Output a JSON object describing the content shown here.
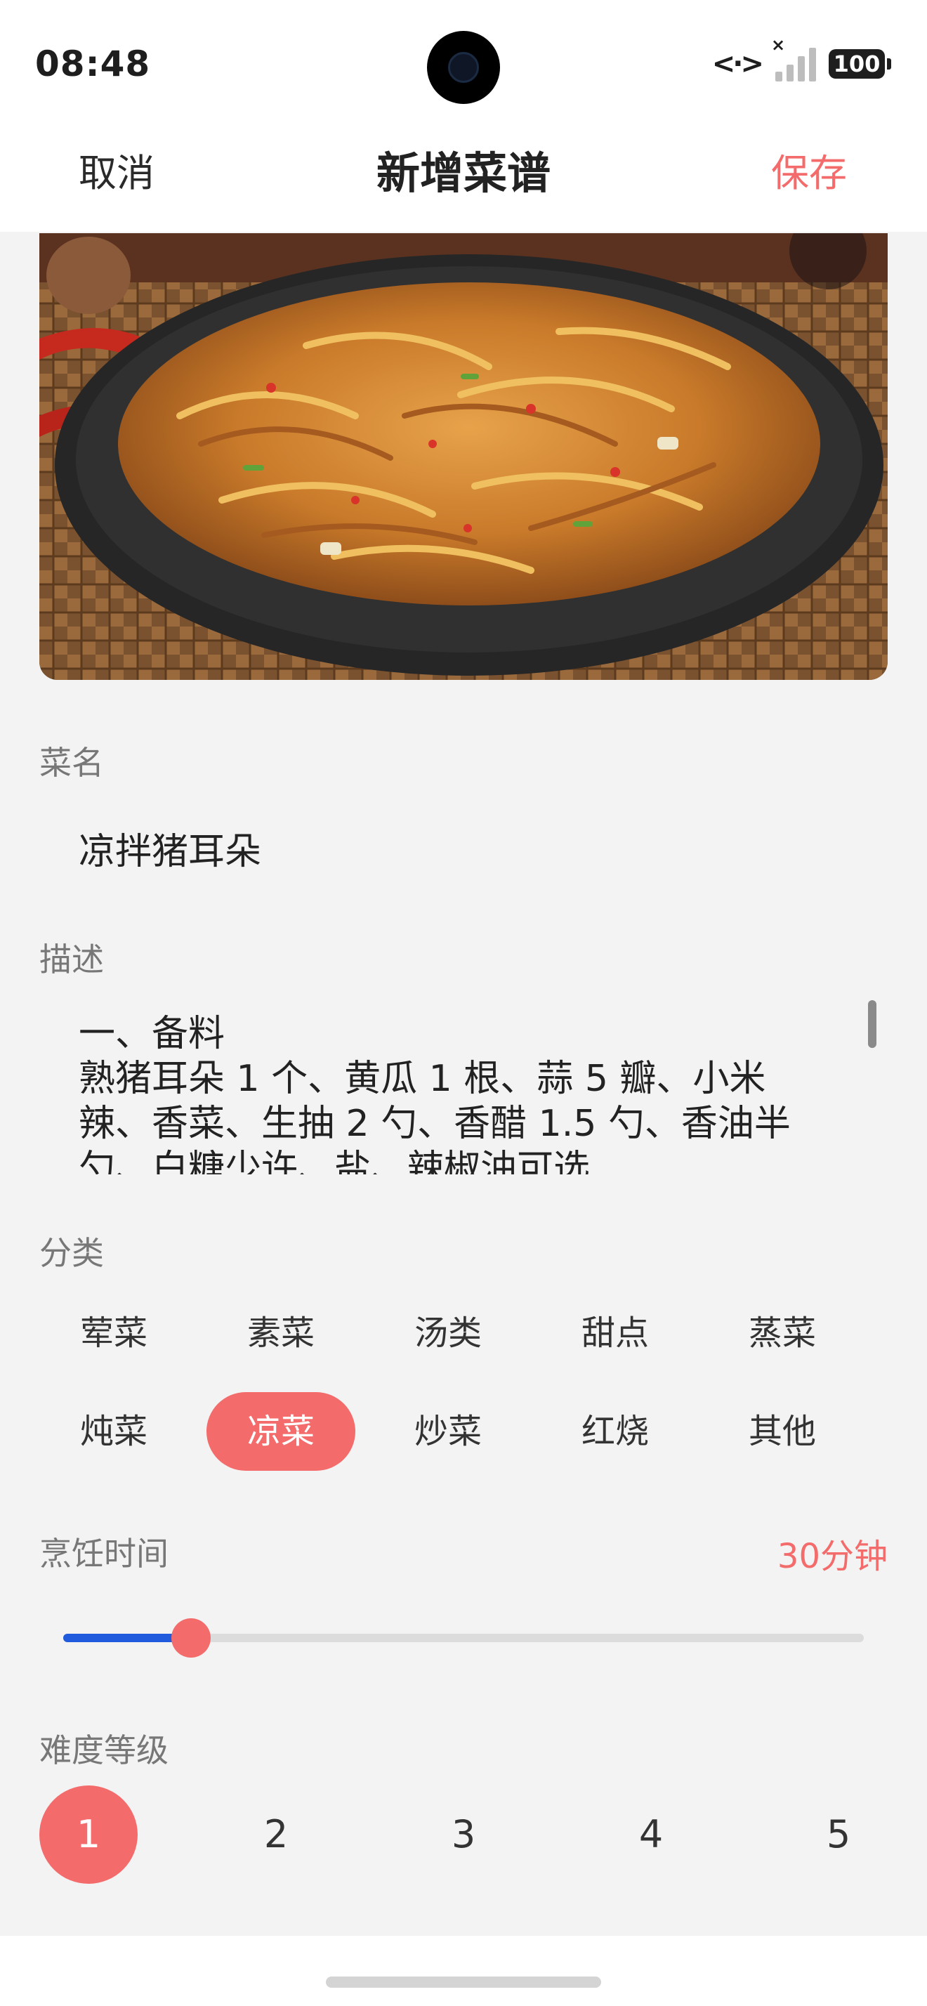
{
  "status_bar": {
    "time": "08:48",
    "battery": "100",
    "icons": [
      "camera-icon",
      "data-transfer-icon",
      "signal-icon",
      "battery-icon"
    ]
  },
  "nav": {
    "cancel_label": "取消",
    "title": "新增菜谱",
    "save_label": "保存"
  },
  "photo": {
    "subject": "dish-photo"
  },
  "form": {
    "name_label": "菜名",
    "name_value": "凉拌猪耳朵",
    "desc_label": "描述",
    "desc_lines": [
      "一、备料",
      "熟猪耳朵 1 个、黄瓜 1 根、蒜 5 瓣、小米",
      "辣、香菜、生抽 2 勺、香醋 1.5 勺、香油半",
      "勺、白糖少许、盐、辣椒油可选"
    ],
    "category_label": "分类",
    "categories": [
      "荤菜",
      "素菜",
      "汤类",
      "甜点",
      "蒸菜",
      "炖菜",
      "凉菜",
      "炒菜",
      "红烧",
      "其他"
    ],
    "selected_category": "凉菜",
    "cook_time_label": "烹饪时间",
    "cook_time_value": "30分钟",
    "cook_time_slider_fraction": 0.16,
    "difficulty_label": "难度等级",
    "difficulty_levels": [
      "1",
      "2",
      "3",
      "4",
      "5"
    ],
    "selected_difficulty": "1"
  },
  "colors": {
    "accent": "#f46b6b",
    "slider_fill": "#1f5bdc",
    "background": "#f3f3f3"
  }
}
